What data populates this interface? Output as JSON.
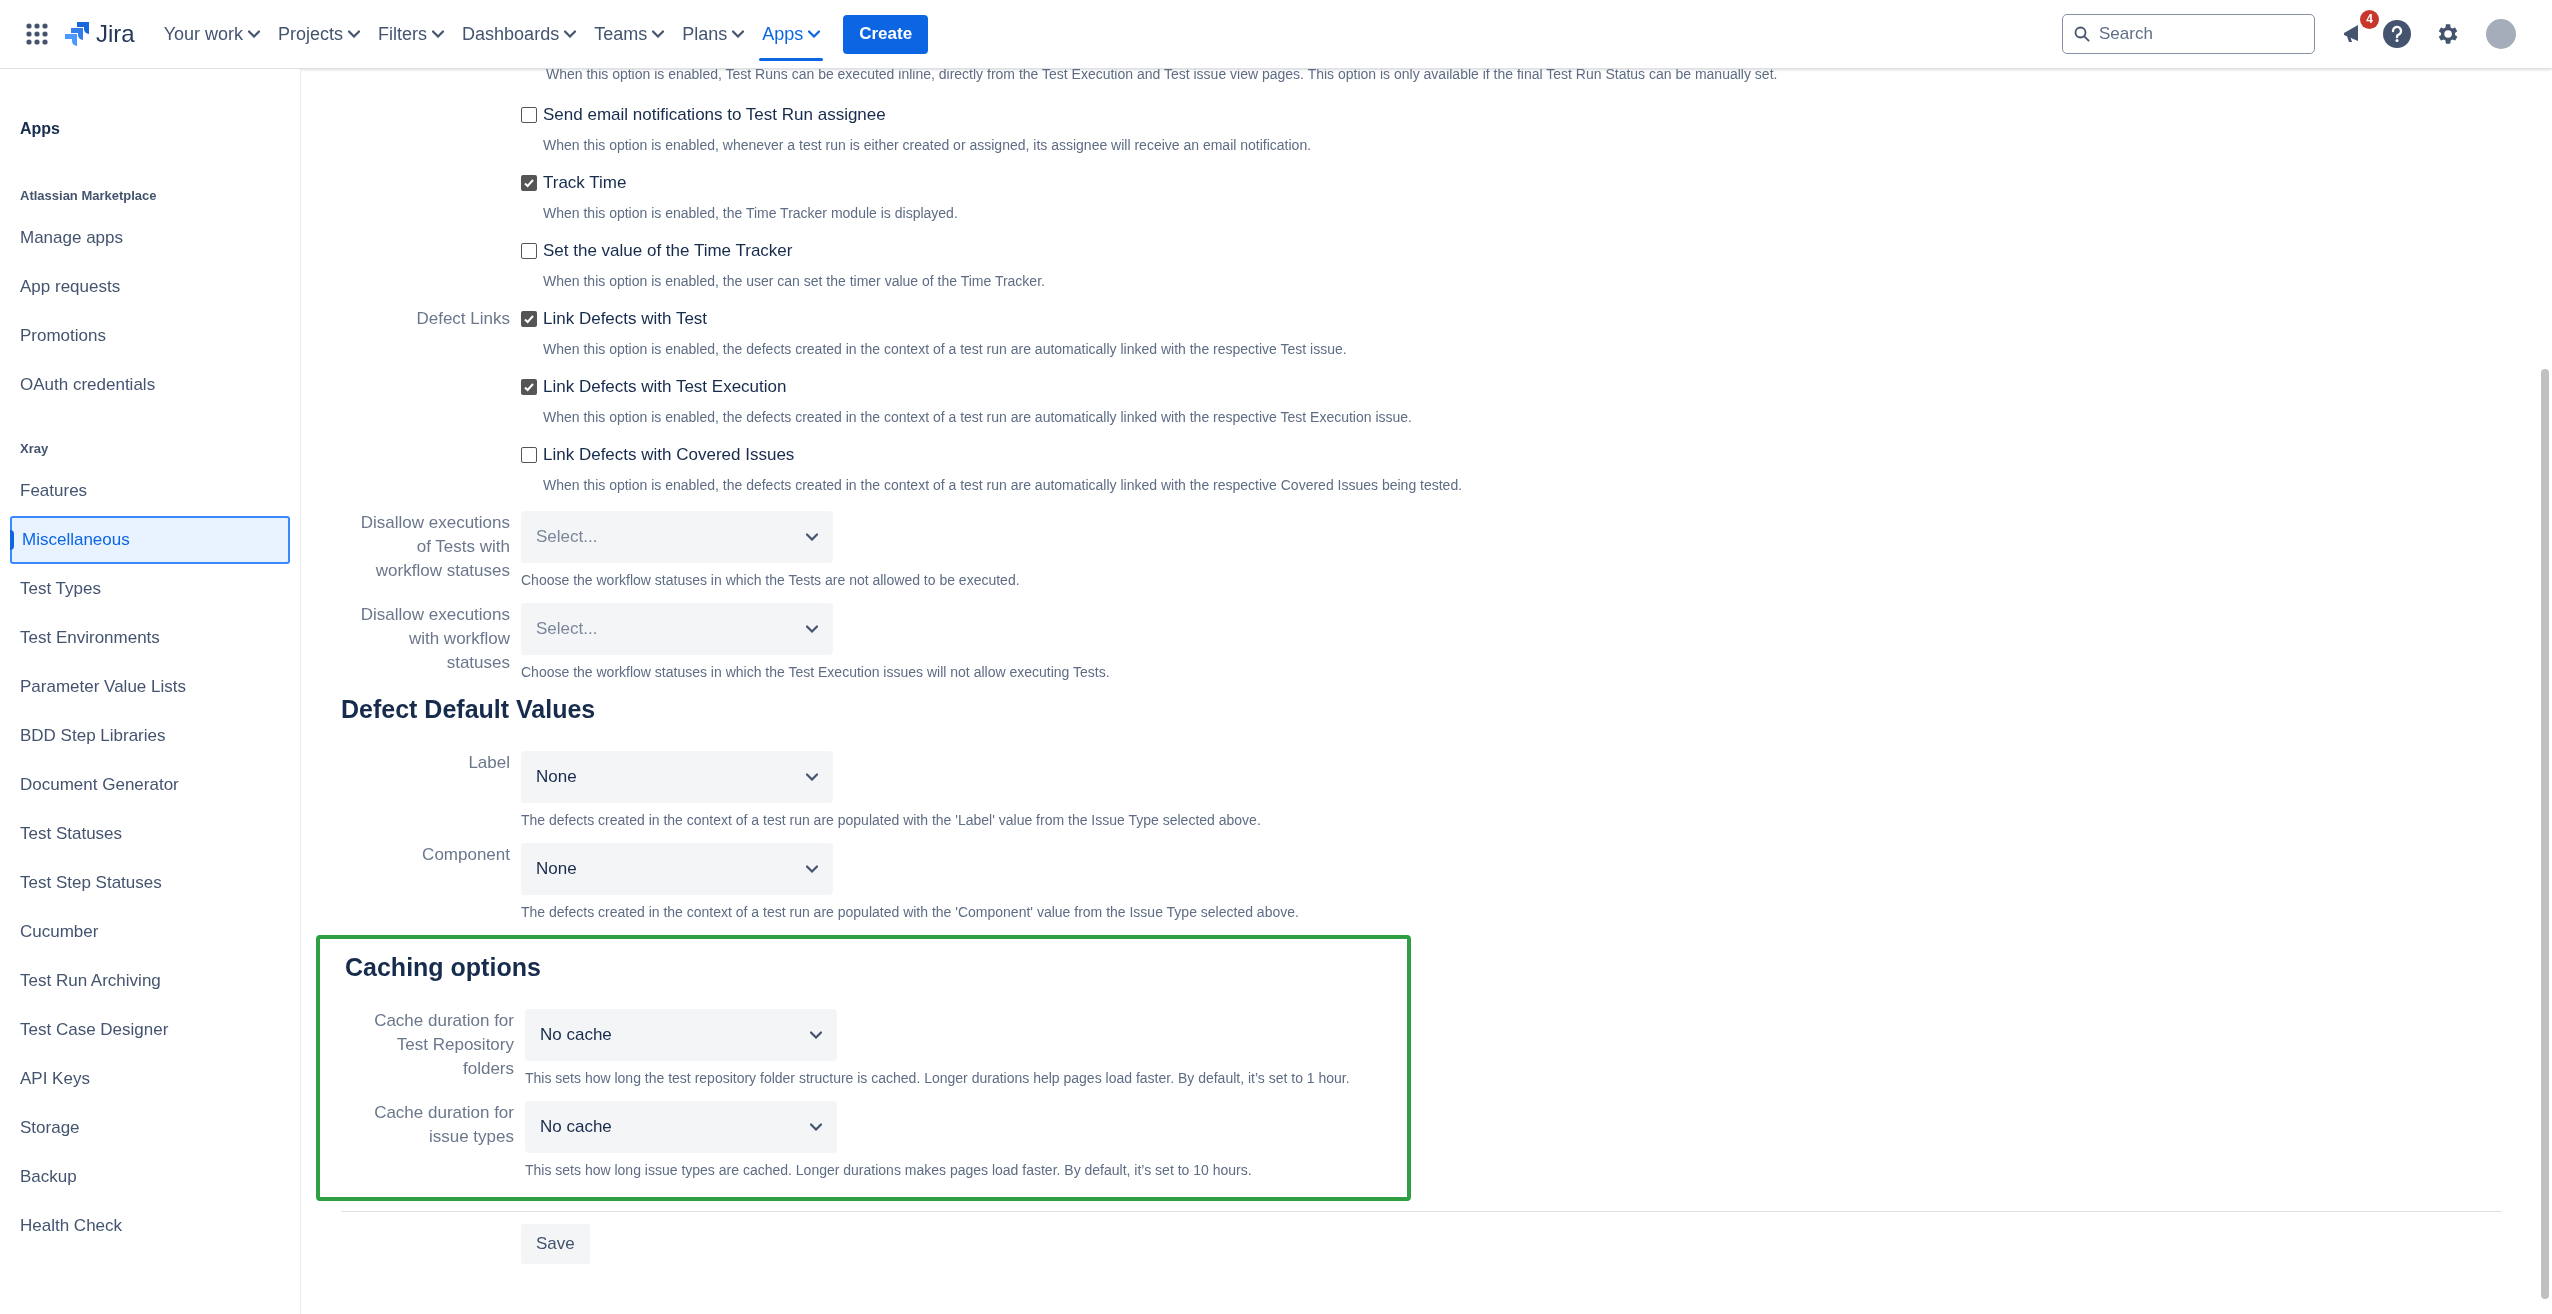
{
  "header": {
    "product": "Jira",
    "nav": [
      {
        "label": "Your work",
        "selected": false
      },
      {
        "label": "Projects",
        "selected": false
      },
      {
        "label": "Filters",
        "selected": false
      },
      {
        "label": "Dashboards",
        "selected": false
      },
      {
        "label": "Teams",
        "selected": false
      },
      {
        "label": "Plans",
        "selected": false
      },
      {
        "label": "Apps",
        "selected": true
      }
    ],
    "create": "Create",
    "search": {
      "placeholder": "Search"
    },
    "notifications": "4"
  },
  "sidebar": {
    "title": "Apps",
    "groups": [
      {
        "heading": "Atlassian Marketplace",
        "items": [
          {
            "label": "Manage apps",
            "selected": false
          },
          {
            "label": "App requests",
            "selected": false
          },
          {
            "label": "Promotions",
            "selected": false
          },
          {
            "label": "OAuth credentials",
            "selected": false
          }
        ]
      },
      {
        "heading": "Xray",
        "items": [
          {
            "label": "Features",
            "selected": false
          },
          {
            "label": "Miscellaneous",
            "selected": true
          },
          {
            "label": "Test Types",
            "selected": false
          },
          {
            "label": "Test Environments",
            "selected": false
          },
          {
            "label": "Parameter Value Lists",
            "selected": false
          },
          {
            "label": "BDD Step Libraries",
            "selected": false
          },
          {
            "label": "Document Generator",
            "selected": false
          },
          {
            "label": "Test Statuses",
            "selected": false
          },
          {
            "label": "Test Step Statuses",
            "selected": false
          },
          {
            "label": "Cucumber",
            "selected": false
          },
          {
            "label": "Test Run Archiving",
            "selected": false
          },
          {
            "label": "Test Case Designer",
            "selected": false
          },
          {
            "label": "API Keys",
            "selected": false
          },
          {
            "label": "Storage",
            "selected": false
          },
          {
            "label": "Backup",
            "selected": false
          },
          {
            "label": "Health Check",
            "selected": false
          }
        ]
      }
    ]
  },
  "sections": [
    {
      "highlighted": false,
      "rows": [
        {
          "kind": "note",
          "description": "When this option is enabled, Test Runs can be executed inline, directly from the Test Execution and Test issue view pages. This option is only available if the final Test Run Status can be manually set."
        },
        {
          "kind": "checkbox",
          "label": "Send email notifications to Test Run assignee",
          "checked": false,
          "description": "When this option is enabled, whenever a test run is either created or assigned, its assignee will receive an email notification."
        },
        {
          "kind": "checkbox",
          "label": "Track Time",
          "checked": true,
          "description": "When this option is enabled, the Time Tracker module is displayed."
        },
        {
          "kind": "checkbox",
          "label": "Set the value of the Time Tracker",
          "checked": false,
          "description": "When this option is enabled, the user can set the timer value of the Time Tracker."
        },
        {
          "kind": "checkbox",
          "group_label": "Defect Links",
          "label": "Link Defects with Test",
          "checked": true,
          "description": "When this option is enabled, the defects created in the context of a test run are automatically linked with the respective Test issue."
        },
        {
          "kind": "checkbox",
          "label": "Link Defects with Test Execution",
          "checked": true,
          "description": "When this option is enabled, the defects created in the context of a test run are automatically linked with the respective Test Execution issue."
        },
        {
          "kind": "checkbox",
          "label": "Link Defects with Covered Issues",
          "checked": false,
          "description": "When this option is enabled, the defects created in the context of a test run are automatically linked with the respective Covered Issues being tested."
        },
        {
          "kind": "select",
          "label": "Disallow executions of Tests with workflow statuses",
          "placeholder": "Select...",
          "description": "Choose the workflow statuses in which the Tests are not allowed to be executed."
        },
        {
          "kind": "select",
          "label": "Disallow executions with workflow statuses",
          "placeholder": "Select...",
          "description": "Choose the workflow statuses in which the Test Execution issues will not allow executing Tests."
        }
      ]
    },
    {
      "title": "Defect Default Values",
      "highlighted": false,
      "rows": [
        {
          "kind": "select",
          "label": "Label",
          "value": "None",
          "description": "The defects created in the context of a test run are populated with the 'Label' value from the Issue Type selected above."
        },
        {
          "kind": "select",
          "label": "Component",
          "value": "None",
          "description": "The defects created in the context of a test run are populated with the 'Component' value from the Issue Type selected above."
        }
      ]
    },
    {
      "title": "Caching options",
      "highlighted": true,
      "rows": [
        {
          "kind": "select",
          "label": "Cache duration for Test Repository folders",
          "value": "No cache",
          "description": "This sets how long the test repository folder structure is cached. Longer durations help pages load faster. By default, it’s set to 1 hour."
        },
        {
          "kind": "select",
          "label": "Cache duration for issue types",
          "value": "No cache",
          "description": "This sets how long issue types are cached. Longer durations makes pages load faster. By default, it’s set to 10 hours."
        }
      ]
    }
  ],
  "save": "Save"
}
